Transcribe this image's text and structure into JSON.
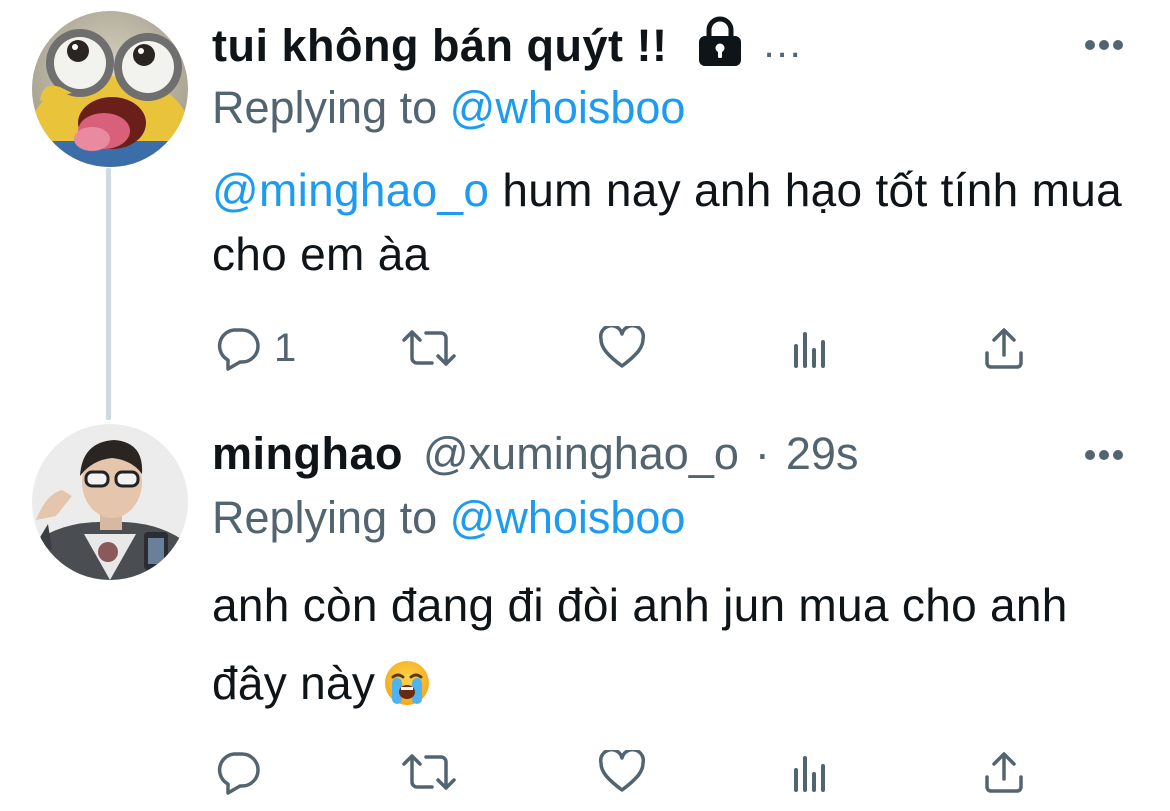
{
  "tweets": [
    {
      "display_name": "tui không bán quýt !!",
      "truncation": "...",
      "reply_prefix": "Replying to ",
      "reply_to": "@whoisboo",
      "mention": "@minghao_o",
      "text_after_mention": " hum nay anh hạo tốt tính mua cho em àa",
      "reply_count": "1",
      "icons": [
        "lock-icon",
        "more-icon",
        "reply-icon",
        "retweet-icon",
        "like-icon",
        "analytics-icon",
        "share-icon"
      ]
    },
    {
      "display_name": "minghao",
      "handle": "@xuminghao_o",
      "separator": "·",
      "time": "29s",
      "reply_prefix": "Replying to ",
      "reply_to": "@whoisboo",
      "text": "anh còn đang đi đòi anh jun mua cho anh đây này",
      "emoji": "loudly-crying-face",
      "icons": [
        "more-icon",
        "reply-icon",
        "retweet-icon",
        "like-icon",
        "analytics-icon",
        "share-icon"
      ]
    }
  ],
  "colors": {
    "text": "#0f1419",
    "secondary": "#536471",
    "link": "#1d9bf0",
    "thread_line": "#cfd9de"
  }
}
